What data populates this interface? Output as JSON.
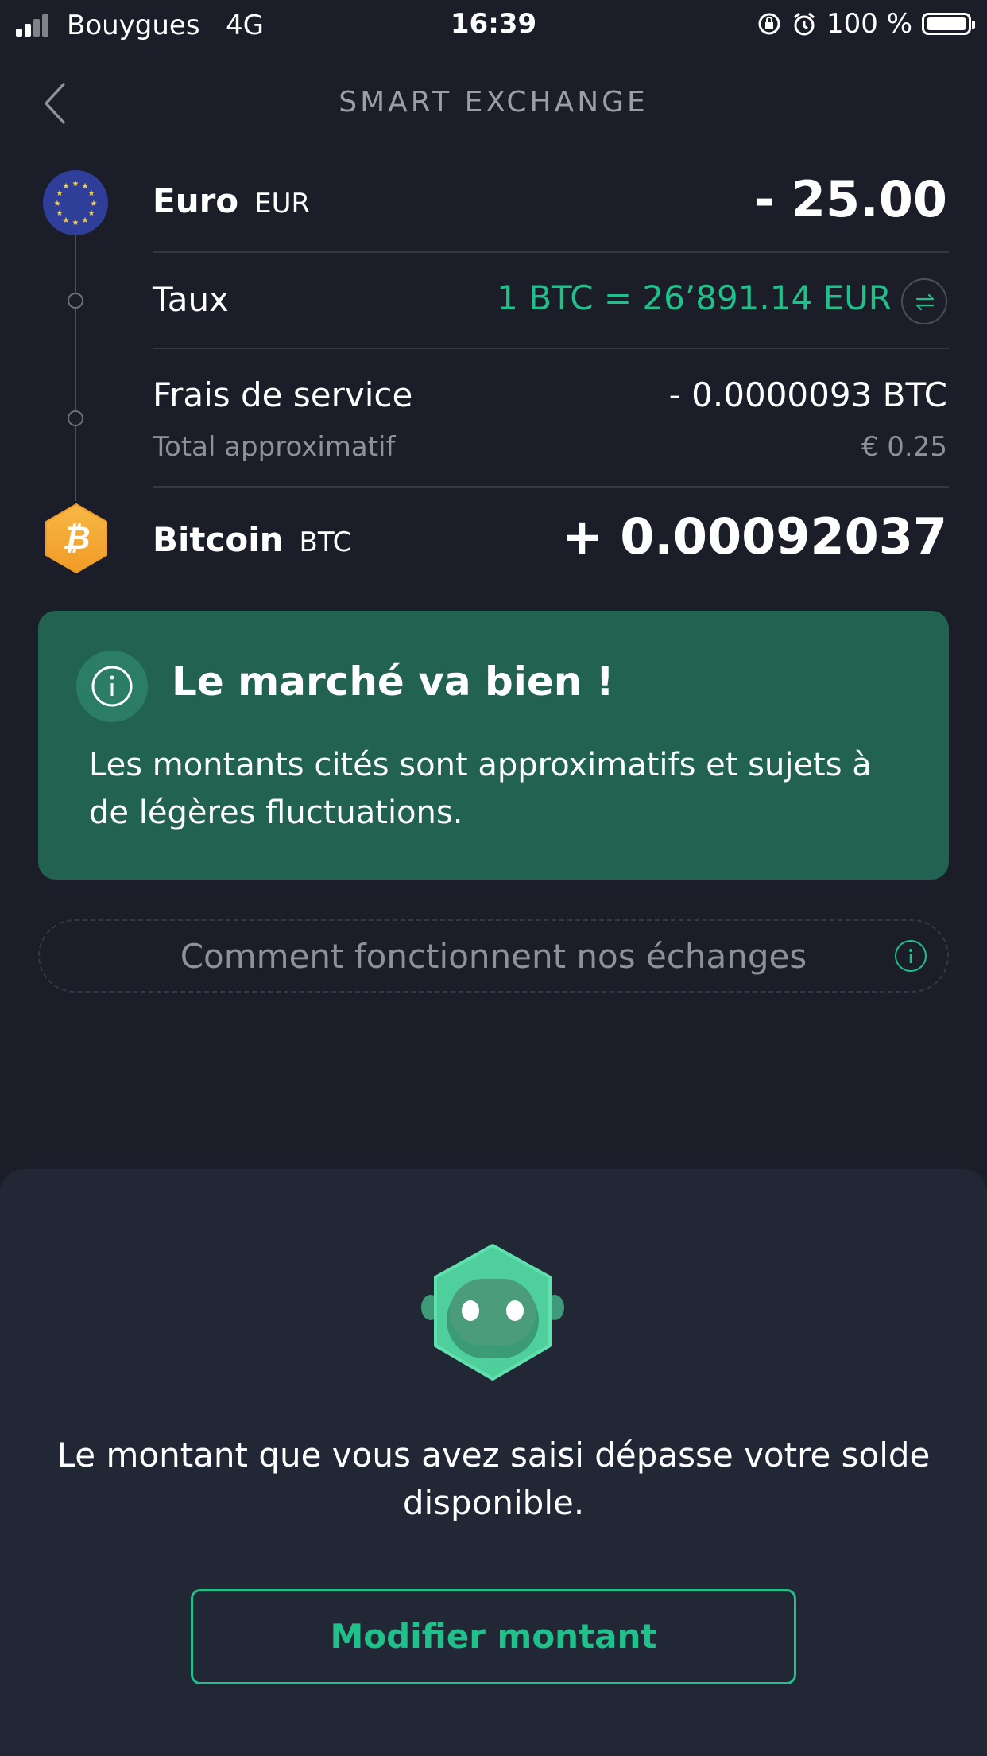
{
  "status_bar": {
    "carrier": "Bouygues",
    "network": "4G",
    "time": "16:39",
    "battery": "100 %"
  },
  "header": {
    "title": "SMART EXCHANGE"
  },
  "exchange": {
    "from": {
      "name": "Euro",
      "code": "EUR",
      "amount": "- 25.00"
    },
    "rate": {
      "label": "Taux",
      "value": "1 BTC = 26’891.14 EUR"
    },
    "fee": {
      "label": "Frais de service",
      "value": "- 0.0000093 BTC",
      "total_label": "Total approximatif",
      "total_value": "€ 0.25"
    },
    "to": {
      "name": "Bitcoin",
      "code": "BTC",
      "amount": "+ 0.00092037"
    }
  },
  "info_card": {
    "title": "Le marché va bien !",
    "body": "Les montants cités sont approximatifs et sujets à de légères fluctuations."
  },
  "how_it_works": {
    "label": "Comment fonctionnent nos échanges"
  },
  "sheet": {
    "message": "Le montant que vous avez saisi dépasse votre solde disponible.",
    "button_label": "Modifier montant"
  },
  "colors": {
    "background": "#1b1e28",
    "accent": "#20c08a",
    "card": "#216350",
    "sheet": "#222735"
  },
  "icons": [
    "back-arrow-icon",
    "euro-flag-icon",
    "bitcoin-icon",
    "swap-icon",
    "info-icon",
    "robot-icon"
  ]
}
